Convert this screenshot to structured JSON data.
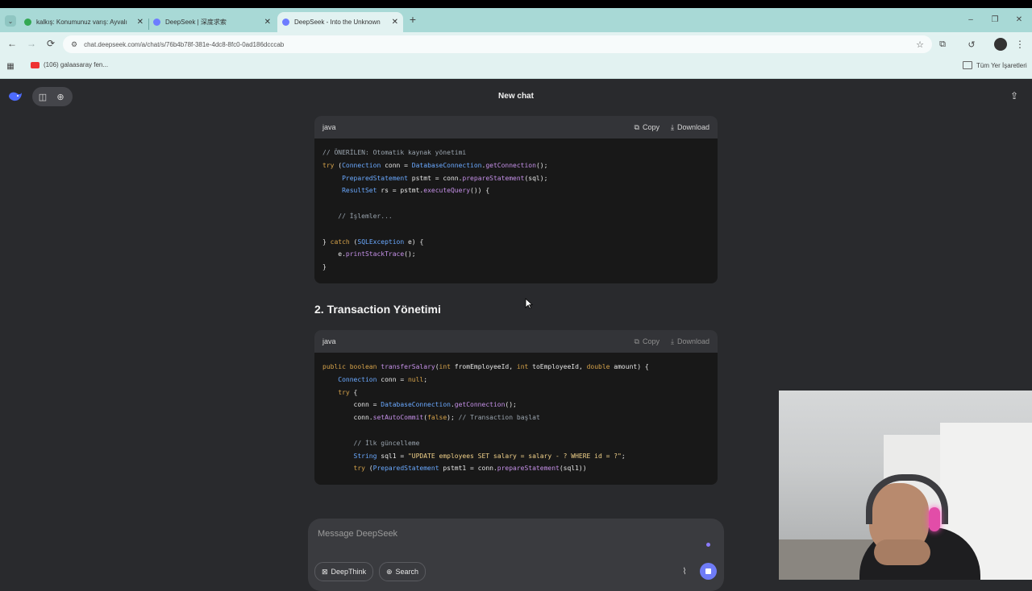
{
  "browser": {
    "tabs": [
      {
        "title": "kalkış: Konumunuz varış: Ayvalı"
      },
      {
        "title": "DeepSeek | 深度求索"
      },
      {
        "title": "DeepSeek - Into the Unknown"
      }
    ],
    "url": "chat.deepseek.com/a/chat/s/76b4b78f-381e-4dc8-8fc0-0ad186dcccab",
    "bookmark_left": "(106) galaasaray fen...",
    "bookmark_right": "Tüm Yer İşaretleri"
  },
  "app": {
    "title": "New chat",
    "icons": [
      "deepseek-logo-icon",
      "sidebar-toggle-icon",
      "new-chat-icon",
      "share-icon"
    ]
  },
  "code_block_1": {
    "lang": "java",
    "copy": "Copy",
    "download": "Download"
  },
  "section_heading": "2. Transaction Yönetimi",
  "code_block_2": {
    "lang": "java",
    "copy": "Copy",
    "download": "Download"
  },
  "composer": {
    "placeholder": "Message DeepSeek",
    "deepthink": "DeepThink",
    "search": "Search",
    "icons": [
      "attach-icon",
      "stop-icon"
    ]
  }
}
